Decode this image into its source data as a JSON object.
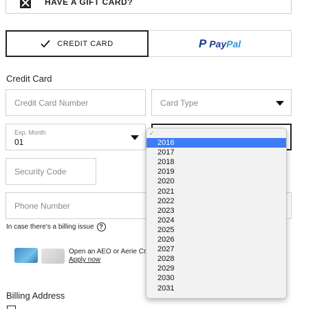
{
  "gift_card": {
    "label": "HAVE A GIFT CARD?",
    "icon": "gift-icon"
  },
  "payment_tabs": {
    "credit_label": "CREDIT CARD",
    "paypal_p": "P",
    "paypal_pay": "Pay",
    "paypal_pal": "Pal"
  },
  "credit_card": {
    "title": "Credit Card",
    "number_placeholder": "Credit Card Number",
    "card_type_placeholder": "Card Type",
    "exp_month_label": "Exp. Month",
    "exp_month_value": "01",
    "security_code_placeholder": "Security Code",
    "phone_placeholder": "Phone Number",
    "billing_note": "In case there's a billing issue",
    "help_glyph": "?"
  },
  "promo": {
    "text": "Open an AEO or Aerie Cr",
    "link": "Apply now"
  },
  "billing": {
    "title": "Billing Address"
  },
  "year_dropdown": {
    "check_mark": "✓",
    "selected": "2016",
    "options": [
      "2016",
      "2017",
      "2018",
      "2019",
      "2020",
      "2021",
      "2022",
      "2023",
      "2024",
      "2025",
      "2026",
      "2027",
      "2028",
      "2029",
      "2030",
      "2031"
    ]
  },
  "colors": {
    "selection": "#3d7bf7",
    "paypal_dark": "#1a3c8f",
    "paypal_light": "#2a96d8"
  }
}
